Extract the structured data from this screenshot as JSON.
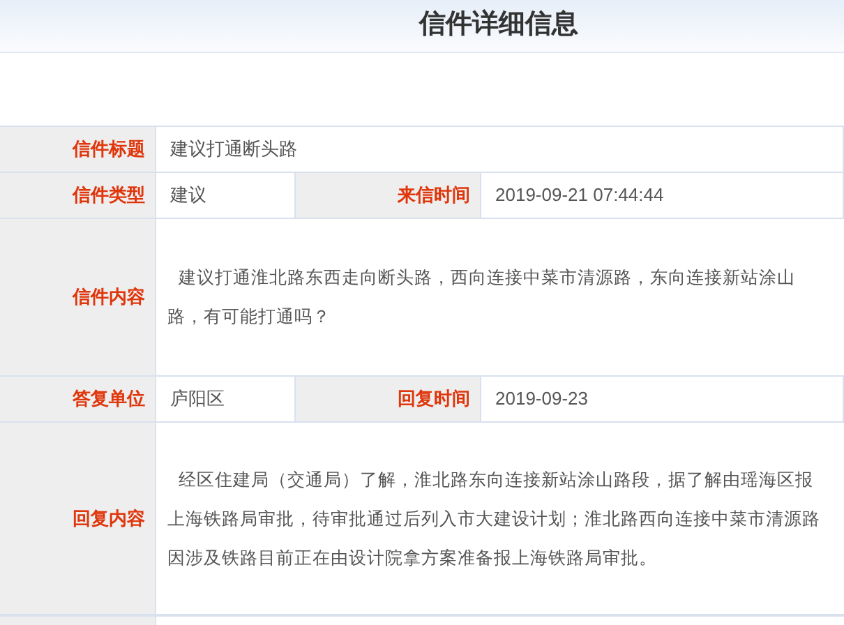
{
  "page_title": "信件详细信息",
  "rows": [
    {
      "kind": "single",
      "label": "信件标题",
      "value": "建议打通断头路"
    },
    {
      "kind": "pair",
      "label": "信件类型",
      "value": "建议",
      "label_2": "来信时间",
      "value_2": "2019-09-21 07:44:44"
    },
    {
      "kind": "long",
      "label": "信件内容",
      "value": "建议打通淮北路东西走向断头路，西向连接中菜市清源路，东向连接新站涂山路，有可能打通吗？"
    },
    {
      "kind": "pair",
      "label": "答复单位",
      "value": "庐阳区",
      "label_2": "回复时间",
      "value_2": "2019-09-23"
    },
    {
      "kind": "long",
      "label": "回复内容",
      "value": "经区住建局（交通局）了解，淮北路东向连接新站涂山路段，据了解由瑶海区报上海铁路局审批，待审批通过后列入市大建设计划；淮北路西向连接中菜市清源路因涉及铁路目前正在由设计院拿方案准备报上海铁路局审批。"
    }
  ]
}
